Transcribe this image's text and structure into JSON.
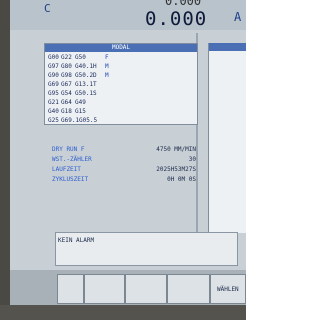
{
  "header": {
    "axis_top": "C",
    "axis_bottom": "A",
    "position_value": "0.000",
    "partial_top": "0.000",
    "axis_right": "A"
  },
  "modal": {
    "title": "MODAL",
    "rows": [
      [
        "G00",
        "G22",
        "G50",
        "F"
      ],
      [
        "G97",
        "G80",
        "G40.1H",
        "M"
      ],
      [
        "G90",
        "G98",
        "G50.2D",
        "M"
      ],
      [
        "G69",
        "G67",
        "G13.1T",
        ""
      ],
      [
        "G95",
        "G54",
        "G50.1S",
        ""
      ],
      [
        "G21",
        "G64",
        "G49",
        ""
      ],
      [
        "G40",
        "G18",
        "G15",
        ""
      ],
      [
        "G25",
        "G69.1G05.5",
        "",
        ""
      ]
    ]
  },
  "info": {
    "rows": [
      {
        "label": "DRY RUN F",
        "value": "4750 MM/MIN"
      },
      {
        "label": "WST.-ZÄHLER",
        "value": "30"
      },
      {
        "label": "LAUFZEIT",
        "value": "2025H53M27S"
      },
      {
        "label": "ZYKLUSZEIT",
        "value": "0H 0M 0S"
      }
    ]
  },
  "alarm": {
    "text": "KEIN ALARM"
  },
  "softkeys": [
    "",
    "",
    "",
    "",
    "WÄHLEN"
  ]
}
